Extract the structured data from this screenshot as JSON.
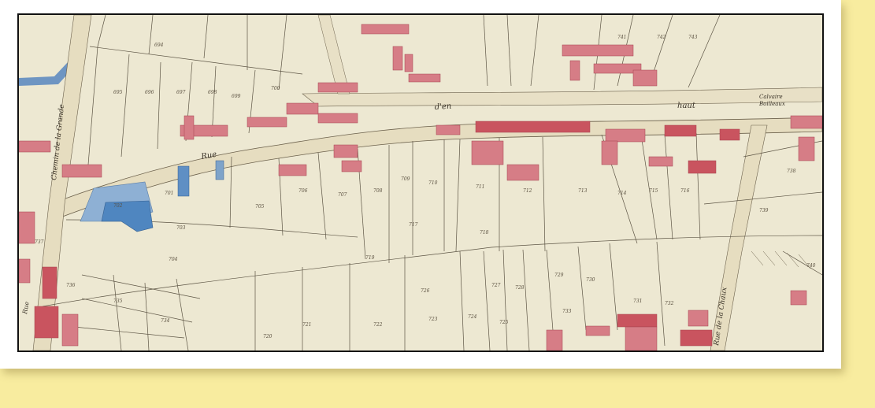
{
  "map": {
    "labels": {
      "chemin": "Chemin de la Grande",
      "rue": "Rue",
      "d_en": "d'en",
      "haut": "haut",
      "calvaire": "Calvaire",
      "calvaire_name": "Boilleaux",
      "rue_de_la_chaux": "Rue de la Chaux",
      "left_edge": "Rue"
    },
    "parcels": [
      "694",
      "695",
      "696",
      "697",
      "698",
      "699",
      "700",
      "701",
      "702",
      "703",
      "704",
      "705",
      "706",
      "707",
      "708",
      "709",
      "710",
      "711",
      "712",
      "713",
      "714",
      "715",
      "716",
      "717",
      "718",
      "719",
      "720",
      "721",
      "722",
      "723",
      "724",
      "725",
      "726",
      "727",
      "728",
      "729",
      "730",
      "731",
      "732",
      "733",
      "734",
      "735",
      "736",
      "737",
      "738",
      "739",
      "740",
      "741",
      "742",
      "743"
    ],
    "colors": {
      "paper": "#ece6cf",
      "building": "#d98a8f",
      "building_dark": "#c9545f",
      "water": "#7ea3c9",
      "blue_parcel": "#4f86c0",
      "road": "#e8e0c4",
      "line": "#5d5545"
    }
  }
}
